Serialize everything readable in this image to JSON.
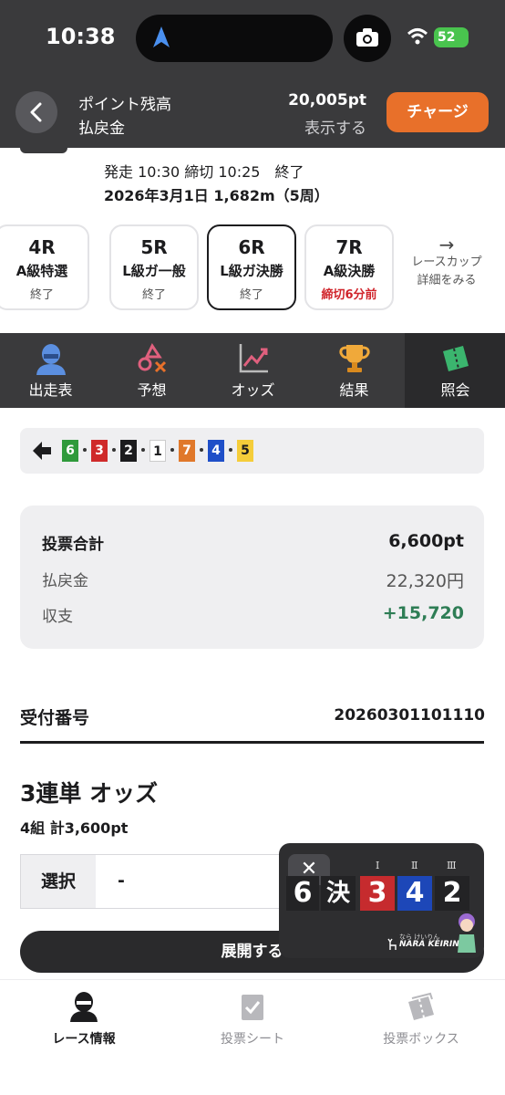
{
  "status_bar": {
    "time": "10:38",
    "battery": "52"
  },
  "header": {
    "points_label": "ポイント残高",
    "refund_label": "払戻金",
    "points_value": "20,005pt",
    "show_link": "表示する",
    "charge_button": "チャージ"
  },
  "race_info": {
    "line1": "発走 10:30 締切 10:25　終了",
    "line2": "2026年3月1日 1,682m（5周）"
  },
  "race_cards": [
    {
      "num": "4R",
      "name": "A級特選",
      "status": "終了",
      "active": false,
      "status_red": false
    },
    {
      "num": "5R",
      "name": "L級ガ一般",
      "status": "終了",
      "active": false,
      "status_red": false
    },
    {
      "num": "6R",
      "name": "L級ガ決勝",
      "status": "終了",
      "active": true,
      "status_red": false
    },
    {
      "num": "7R",
      "name": "A級決勝",
      "status": "締切6分前",
      "active": false,
      "status_red": true
    }
  ],
  "cup_link": {
    "arrow": "→",
    "line1": "レースカップ",
    "line2": "詳細をみる"
  },
  "tabs": [
    {
      "label": "出走表",
      "icon": "racer-icon"
    },
    {
      "label": "予想",
      "icon": "prediction-icon"
    },
    {
      "label": "オッズ",
      "icon": "odds-chart-icon"
    },
    {
      "label": "結果",
      "icon": "trophy-icon"
    },
    {
      "label": "照会",
      "icon": "ticket-icon",
      "active": true
    }
  ],
  "sequence": [
    {
      "n": "6",
      "bg": "#2f9a3b",
      "fg": "#ffffff"
    },
    {
      "n": "3",
      "bg": "#cf2a2a",
      "fg": "#ffffff"
    },
    {
      "n": "2",
      "bg": "#1c1c1e",
      "fg": "#ffffff"
    },
    {
      "n": "1",
      "bg": "#ffffff",
      "fg": "#1c1c1e"
    },
    {
      "n": "7",
      "bg": "#e0782a",
      "fg": "#ffffff"
    },
    {
      "n": "4",
      "bg": "#1f4fc8",
      "fg": "#ffffff"
    },
    {
      "n": "5",
      "bg": "#f5cd3a",
      "fg": "#1c1c1e"
    }
  ],
  "summary": {
    "total_label": "投票合計",
    "total_value": "6,600pt",
    "refund_label": "払戻金",
    "refund_value": "22,320円",
    "balance_label": "収支",
    "balance_value": "+15,720",
    "balance_color": "#2e7d55"
  },
  "receipt": {
    "label": "受付番号",
    "value": "20260301101110"
  },
  "odds": {
    "title": "3連単 オッズ",
    "subtitle": "4組 計3,600pt",
    "select_label": "選択",
    "select_value": "-",
    "expand_button": "展開する"
  },
  "video": {
    "close": "✕",
    "rank_1": "Ⅰ",
    "rank_2": "Ⅱ",
    "rank_3": "Ⅲ",
    "race_no": "6",
    "race_type": "決",
    "first": "3",
    "second": "4",
    "third": "2",
    "logo_kana": "なら けいりん",
    "logo": "NARA KEIRIN"
  },
  "bottom_nav": [
    {
      "label": "レース情報",
      "active": true
    },
    {
      "label": "投票シート",
      "active": false
    },
    {
      "label": "投票ボックス",
      "active": false
    }
  ]
}
